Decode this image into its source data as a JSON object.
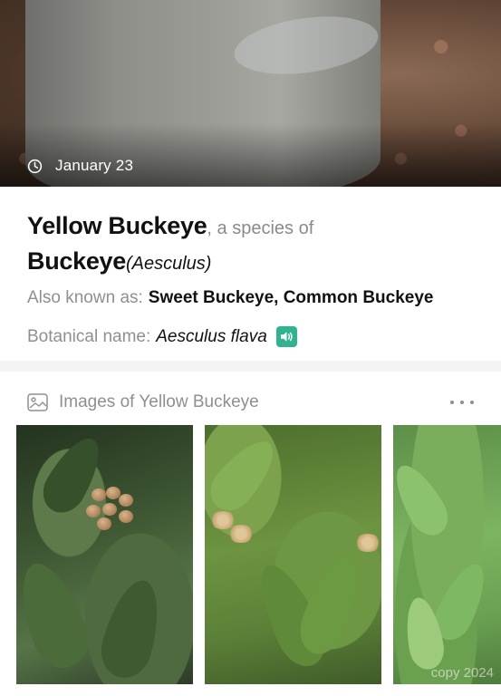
{
  "hero": {
    "date": "January 23"
  },
  "species": {
    "common_name": "Yellow Buckeye",
    "separator": ", a species of",
    "genus_common": "Buckeye",
    "genus_latin": "(Aesculus)"
  },
  "also_known": {
    "label": "Also known as:",
    "value": "Sweet Buckeye, Common Buckeye"
  },
  "botanical": {
    "label": "Botanical name:",
    "value": "Aesculus flava"
  },
  "images": {
    "title": "Images of Yellow Buckeye",
    "watermark": "copy 2024"
  },
  "colors": {
    "accent": "#2fb48f",
    "muted_text": "#8f8f8f"
  },
  "icons": {
    "date": "clock-icon",
    "pronounce": "speaker-icon",
    "images": "gallery-icon",
    "more": "more-dots-icon"
  }
}
